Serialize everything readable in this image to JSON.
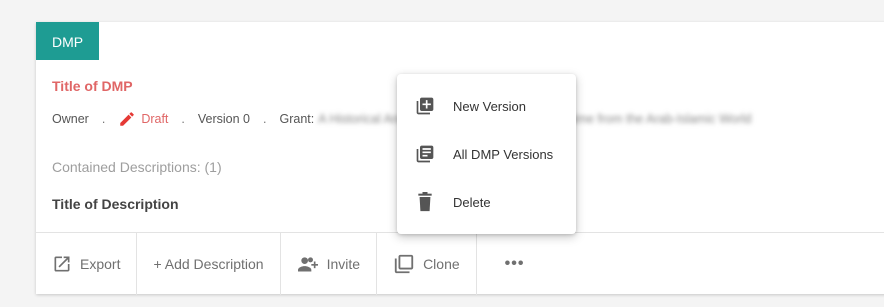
{
  "card": {
    "badge": "DMP",
    "title": "Title of DMP",
    "meta": {
      "owner": "Owner",
      "separator": ".",
      "status": "Draft",
      "version": "Version 0",
      "grant_label": "Grant:",
      "grant_value": "A Historical Analysis of the Human Rights Regime from the Arab-Islamic World"
    },
    "contained_descriptions": "Contained Descriptions: (1)",
    "description_title": "Title of Description",
    "actions": {
      "export": "Export",
      "add_description": "+ Add Description",
      "invite": "Invite",
      "clone": "Clone",
      "more": "•••"
    }
  },
  "menu": {
    "items": [
      {
        "label": "New Version",
        "icon": "library-add-icon"
      },
      {
        "label": "All DMP Versions",
        "icon": "library-books-icon"
      },
      {
        "label": "Delete",
        "icon": "trash-icon"
      }
    ]
  },
  "colors": {
    "badge": "#1e9c93",
    "accent_red": "#e06666",
    "text_muted": "#9e9e9e"
  }
}
